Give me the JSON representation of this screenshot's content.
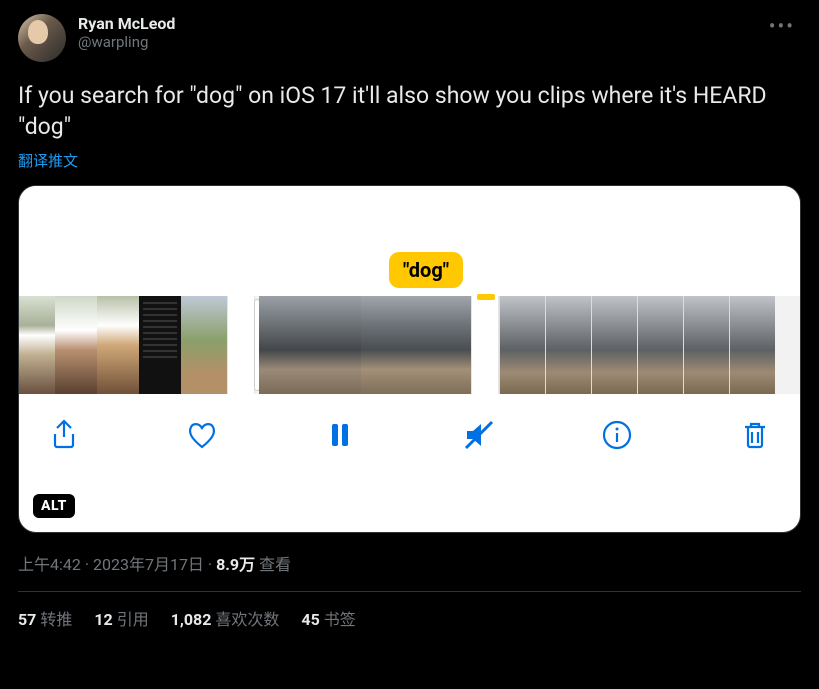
{
  "author": {
    "display_name": "Ryan McLeod",
    "handle": "@warpling"
  },
  "tweet_text": "If you search for \"dog\" on iOS 17 it'll also show you clips where it's HEARD \"dog\"",
  "translate_label": "翻译推文",
  "media": {
    "tooltip": "\"dog\"",
    "alt_badge": "ALT"
  },
  "meta": {
    "time": "上午4:42",
    "date": "2023年7月17日",
    "views_number": "8.9万",
    "views_label": "查看"
  },
  "stats": {
    "retweets_num": "57",
    "retweets_label": "转推",
    "quotes_num": "12",
    "quotes_label": "引用",
    "likes_num": "1,082",
    "likes_label": "喜欢次数",
    "bookmarks_num": "45",
    "bookmarks_label": "书签"
  }
}
